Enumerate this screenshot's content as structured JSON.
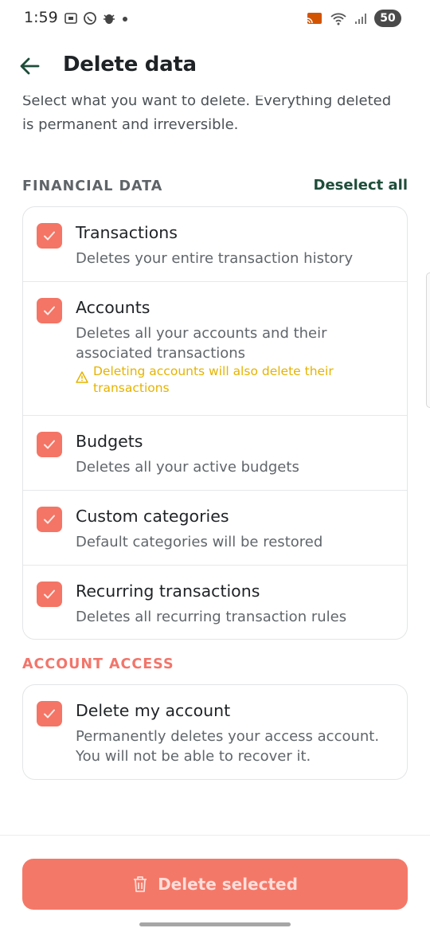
{
  "status_bar": {
    "time": "1:59",
    "battery": "50"
  },
  "app_bar": {
    "title": "Delete data"
  },
  "intro": "Select what you want to delete. Everything deleted is permanent and irreversible.",
  "financial": {
    "title": "FINANCIAL DATA",
    "deselect_all": "Deselect all",
    "items": [
      {
        "title": "Transactions",
        "desc": "Deletes your entire transaction history",
        "checked": true
      },
      {
        "title": "Accounts",
        "desc": "Deletes all your accounts and their associated transactions",
        "warning": "Deleting accounts will also delete their transactions",
        "checked": true
      },
      {
        "title": "Budgets",
        "desc": "Deletes all your active budgets",
        "checked": true
      },
      {
        "title": "Custom categories",
        "desc": "Default categories will be restored",
        "checked": true
      },
      {
        "title": "Recurring transactions",
        "desc": "Deletes all recurring transaction rules",
        "checked": true
      }
    ]
  },
  "account_access": {
    "title": "ACCOUNT ACCESS",
    "items": [
      {
        "title": "Delete my account",
        "desc": "Permanently deletes your access account. You will not be able to recover it.",
        "checked": true
      }
    ]
  },
  "delete_button": {
    "label": "Delete selected"
  },
  "colors": {
    "accent": "#f47565",
    "deselect": "#1e4d3a",
    "warning": "#e5b300",
    "section_danger": "#f2756a"
  },
  "icons": [
    "back-arrow-icon",
    "checkmark-icon",
    "warning-icon",
    "trash-icon"
  ]
}
